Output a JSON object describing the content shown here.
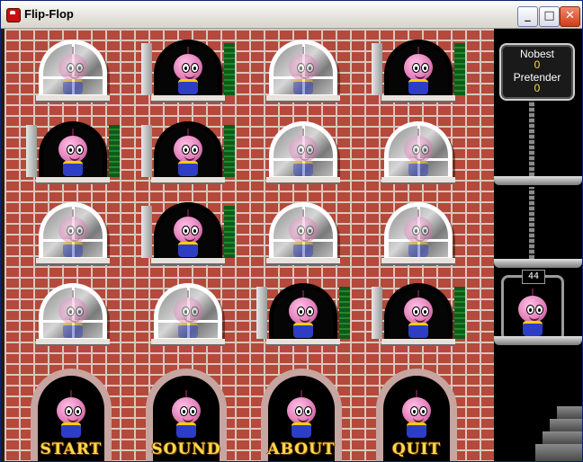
{
  "window": {
    "title": "Flip-Flop",
    "minimize_glyph": "_",
    "maximize_glyph": "□",
    "close_glyph": "✕"
  },
  "scoreboard": {
    "player1_name": "Nobest",
    "player1_score": "0",
    "player2_name": "Pretender",
    "player2_score": "0"
  },
  "counter": "44",
  "colors": {
    "brick": "#b5493b",
    "button_text": "#ffd84a",
    "shutter_green": "#1e8a2a"
  },
  "grid": [
    [
      "closed",
      "open",
      "closed",
      "open"
    ],
    [
      "open",
      "open",
      "closed",
      "closed"
    ],
    [
      "closed",
      "open",
      "closed",
      "closed"
    ],
    [
      "closed",
      "closed",
      "open",
      "open"
    ]
  ],
  "buttons": {
    "start": "START",
    "sound": "SOUND",
    "about": "ABOUT",
    "quit": "QUIT"
  }
}
